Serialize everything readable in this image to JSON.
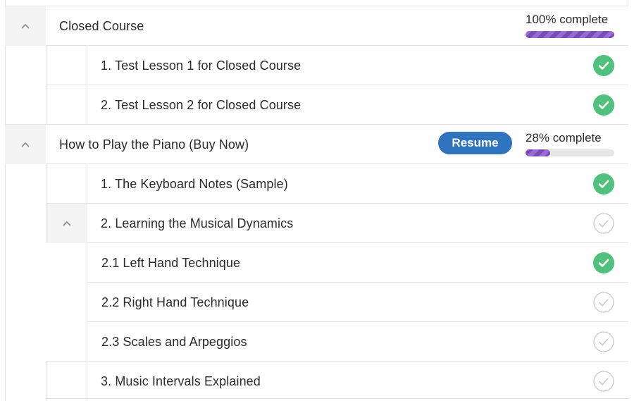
{
  "course_outline": {
    "sections": [
      {
        "title": "Closed Course",
        "progress_label": "100% complete",
        "progress": 1.0,
        "expanded": true,
        "lessons": [
          {
            "title": "1. Test Lesson 1 for Closed Course",
            "completed": true
          },
          {
            "title": "2. Test Lesson 2 for Closed Course",
            "completed": true
          }
        ]
      },
      {
        "title": "How to Play the Piano (Buy Now)",
        "resume_label": "Resume",
        "progress_label": "28% complete",
        "progress": 0.28,
        "expanded": true,
        "lessons": [
          {
            "title": "1. The Keyboard Notes (Sample)",
            "completed": true
          },
          {
            "title": "2. Learning the Musical Dynamics",
            "completed": false,
            "expanded": true,
            "topics": [
              {
                "title": "2.1 Left Hand Technique",
                "completed": true
              },
              {
                "title": "2.2 Right Hand Technique",
                "completed": false
              },
              {
                "title": "2.3 Scales and Arpeggios",
                "completed": false
              }
            ]
          },
          {
            "title": "3. Music Intervals Explained",
            "completed": false
          }
        ]
      }
    ]
  },
  "colors": {
    "complete_green": "#4fc17d",
    "incomplete_gray": "#c9c9c9",
    "progress_purple": "#7b4bb8",
    "resume_blue": "#3074c0"
  },
  "icons": {
    "toggle": "chevron-up-icon",
    "complete": "check-circle-filled-icon",
    "incomplete": "check-circle-outline-icon"
  }
}
